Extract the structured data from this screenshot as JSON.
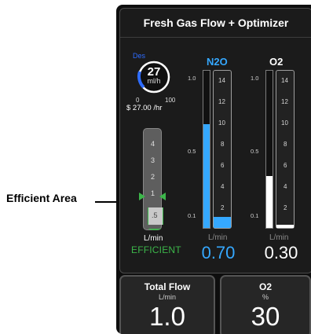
{
  "callout": {
    "label": "Efficient Area"
  },
  "header": {
    "title": "Fresh Gas Flow + Optimizer"
  },
  "agent_gauge": {
    "agent": "Des",
    "value": "27",
    "unit": "ml/h",
    "min": "0",
    "max": "100",
    "cost": "$ 27.00 /hr",
    "level": 0.27
  },
  "efficiency_tube": {
    "ticks": [
      "4",
      "3",
      "2",
      "1",
      ".5"
    ],
    "unit": "L/min",
    "status": "EFFICIENT"
  },
  "n2o": {
    "name": "N2O",
    "scale_top": "1.0",
    "scale_mid": "0.5",
    "scale_low": "0.1",
    "ticks": [
      "14",
      "12",
      "10",
      "8",
      "6",
      "4",
      "2"
    ],
    "unit": "L/min",
    "flow": "0.70",
    "bar_level": 0.66,
    "tube_level": 0.07,
    "color": "#35a8ff"
  },
  "o2": {
    "name": "O2",
    "scale_top": "1.0",
    "scale_mid": "0.5",
    "scale_low": "0.1",
    "ticks": [
      "14",
      "12",
      "10",
      "8",
      "6",
      "4",
      "2"
    ],
    "unit": "L/min",
    "flow": "0.30",
    "bar_level": 0.33,
    "tube_level": 0.02,
    "color": "#ffffff"
  },
  "buttons": {
    "total_flow": {
      "title": "Total Flow",
      "unit": "L/min",
      "value": "1.0"
    },
    "o2_percent": {
      "title": "O2",
      "unit": "%",
      "value": "30"
    }
  }
}
